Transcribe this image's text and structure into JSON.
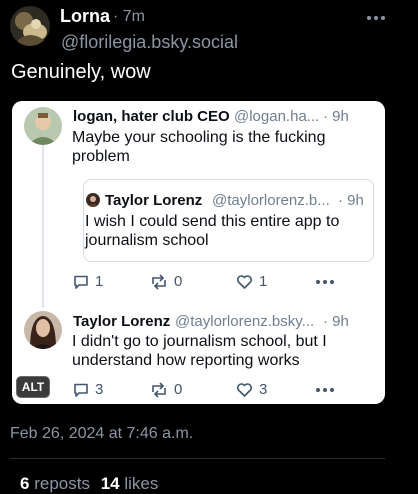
{
  "post": {
    "author_name": "Lorna",
    "time": "· 7m",
    "handle": "@florilegia.bsky.social",
    "text": "Genuinely, wow"
  },
  "embed": {
    "reply": {
      "author_name": "logan, hater club CEO",
      "handle": "@logan.ha...",
      "time": "· 9h",
      "text_line1": "Maybe your schooling is the fucking",
      "text_line2": "problem",
      "quote": {
        "author_name": "Taylor Lorenz",
        "handle": "@taylorlorenz.b...",
        "time": "· 9h",
        "text_line1": "I wish I could send this entire app to",
        "text_line2": "journalism school"
      },
      "actions": {
        "replies": "1",
        "reposts": "0",
        "likes": "1"
      }
    },
    "response": {
      "author_name": "Taylor Lorenz",
      "handle": "@taylorlorenz.bsky...",
      "time": "· 9h",
      "text_line1": "I didn't go to journalism school, but I",
      "text_line2": "understand how reporting works",
      "actions": {
        "replies": "3",
        "reposts": "0",
        "likes": "3"
      }
    }
  },
  "alt_badge": "ALT",
  "timestamp": "Feb 26, 2024 at 7:46 a.m.",
  "stats": {
    "reposts_count": "6",
    "reposts_label": "reposts",
    "likes_count": "14",
    "likes_label": "likes"
  },
  "icons": [
    "more-dots-icon",
    "reply-icon",
    "repost-icon",
    "like-icon"
  ],
  "colors": {
    "background": "#000000",
    "embed_background": "#ffffff",
    "muted_dark": "#8a96a3",
    "muted_light": "#6f7f90"
  }
}
